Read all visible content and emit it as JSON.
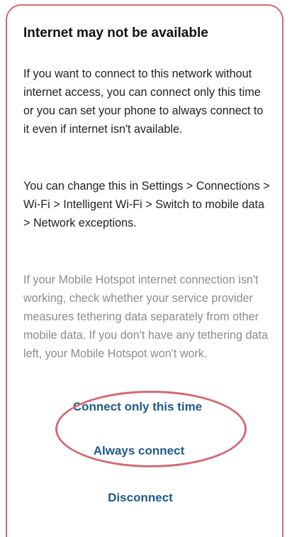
{
  "dialog": {
    "title": "Internet may not be available",
    "paragraph_1": "If you want to connect to this network without internet access, you can connect only this time or you can set your phone to always connect to it even if internet isn't available.",
    "paragraph_2": "You can change this in Settings > Connections > Wi-Fi > Intelligent Wi-Fi > Switch to mobile data > Network exceptions.",
    "paragraph_3": "If your Mobile Hotspot internet connection isn't working, check whether your service provider measures tethering data separately from other mobile data. If you don't have any tethering data left, your Mobile Hotspot won't work.",
    "buttons": {
      "connect_once": "Connect only this time",
      "always_connect": "Always connect",
      "disconnect": "Disconnect"
    }
  },
  "colors": {
    "accent": "#1e5a8a",
    "highlight": "#d46a73",
    "secondary_text": "#8c8c8c"
  }
}
